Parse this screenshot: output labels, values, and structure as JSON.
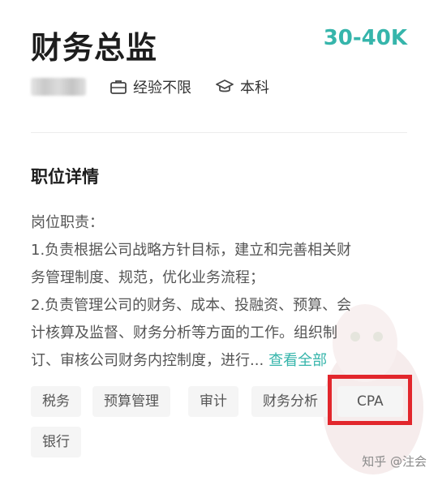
{
  "job": {
    "title": "财务总监",
    "salary": "30-40K",
    "experience": "经验不限",
    "education": "本科"
  },
  "details": {
    "section_title": "职位详情",
    "lines": [
      "岗位职责：",
      "1.负责根据公司战略方针目标，建立和完善相关财",
      "务管理制度、规范，优化业务流程；",
      "2.负责管理公司的财务、成本、投融资、预算、会",
      "计核算及监督、财务分析等方面的工作。组织制",
      "订、审核公司财务内控制度，进行..."
    ],
    "see_all": "查看全部"
  },
  "tags": [
    "税务",
    "预算管理",
    "审计",
    "财务分析",
    "CPA",
    "银行"
  ],
  "watermark": "知乎 @注会",
  "colors": {
    "accent": "#36b5ab",
    "highlight": "#e2262c"
  },
  "icons": {
    "experience": "briefcase-icon",
    "education": "graduation-cap-icon"
  }
}
